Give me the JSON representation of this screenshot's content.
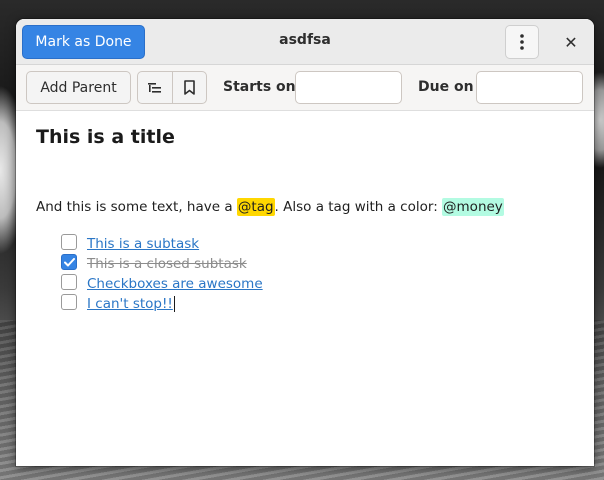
{
  "window": {
    "title": "asdfsa"
  },
  "headerbar": {
    "mark_done_label": "Mark as Done",
    "menu_icon": "kebab-menu-icon",
    "close_icon": "close-icon",
    "close_glyph": "✕"
  },
  "toolbar": {
    "add_parent_label": "Add Parent",
    "subtask_icon": "add-subtask-icon",
    "tag_icon": "bookmark-icon",
    "starts_on_label": "Starts on",
    "starts_on_value": "",
    "due_on_label": "Due on",
    "due_on_value": ""
  },
  "document": {
    "title": "This is a title",
    "text_before_tag": "And this is some text, have a ",
    "tag1": "@tag",
    "text_middle": ". Also a tag with a color: ",
    "tag2": "@money",
    "tag1_color": "#ffd700",
    "tag2_color": "#b3fbe2",
    "subtasks": [
      {
        "label": "This is a subtask",
        "checked": false
      },
      {
        "label": "This is a closed subtask",
        "checked": true
      },
      {
        "label": "Checkboxes are awesome",
        "checked": false
      },
      {
        "label": "I can't stop!!",
        "checked": false
      }
    ]
  },
  "colors": {
    "accent": "#3584e4",
    "link": "#2a76c6"
  }
}
